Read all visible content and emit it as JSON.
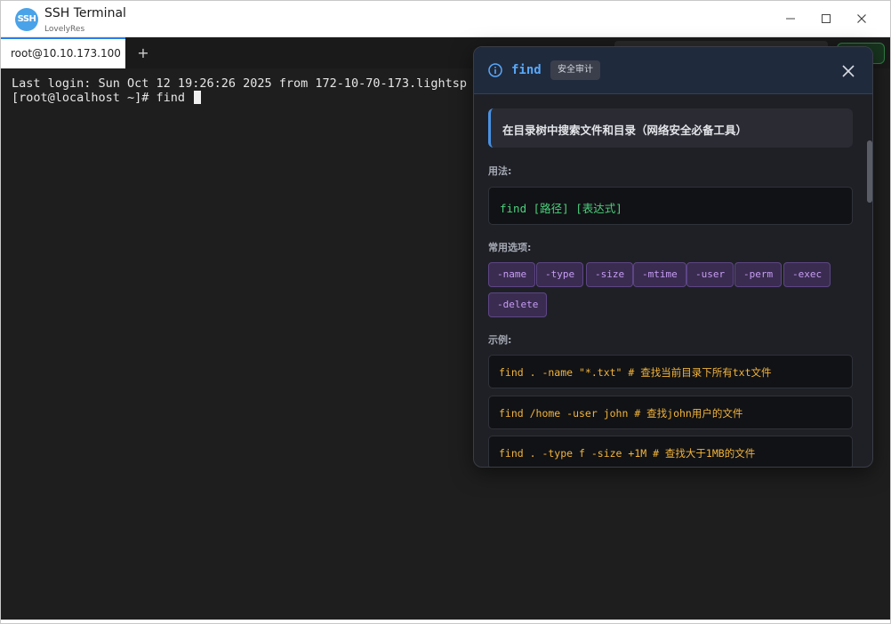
{
  "window": {
    "title": "SSH Terminal",
    "subtitle": "LovelyRes",
    "logo_text": "SSH"
  },
  "tabs": [
    {
      "label": "root@10.10.173.100",
      "active": true
    }
  ],
  "add_tab_label": "+",
  "terminal": {
    "lines": [
      "Last login: Sun Oct 12 19:26:26 2025 from 172-10-70-173.lightsp",
      "[root@localhost ~]# find "
    ]
  },
  "popup": {
    "command": "find",
    "category": "安全审计",
    "description": "在目录树中搜索文件和目录（网络安全必备工具）",
    "usage_label": "用法:",
    "usage": "find [路径] [表达式]",
    "options_label": "常用选项:",
    "options": [
      "-name",
      "-type",
      "-size",
      "-mtime",
      "-user",
      "-perm",
      "-exec",
      "-delete"
    ],
    "examples_label": "示例:",
    "examples": [
      "find . -name \"*.txt\" # 查找当前目录下所有txt文件",
      "find /home -user john # 查找john用户的文件",
      "find . -type f -size +1M # 查找大于1MB的文件"
    ]
  },
  "colors": {
    "accent": "#58a8f8",
    "usage_green": "#4cd07d",
    "option_purple": "#c79df5",
    "example_orange": "#f2b43c"
  }
}
